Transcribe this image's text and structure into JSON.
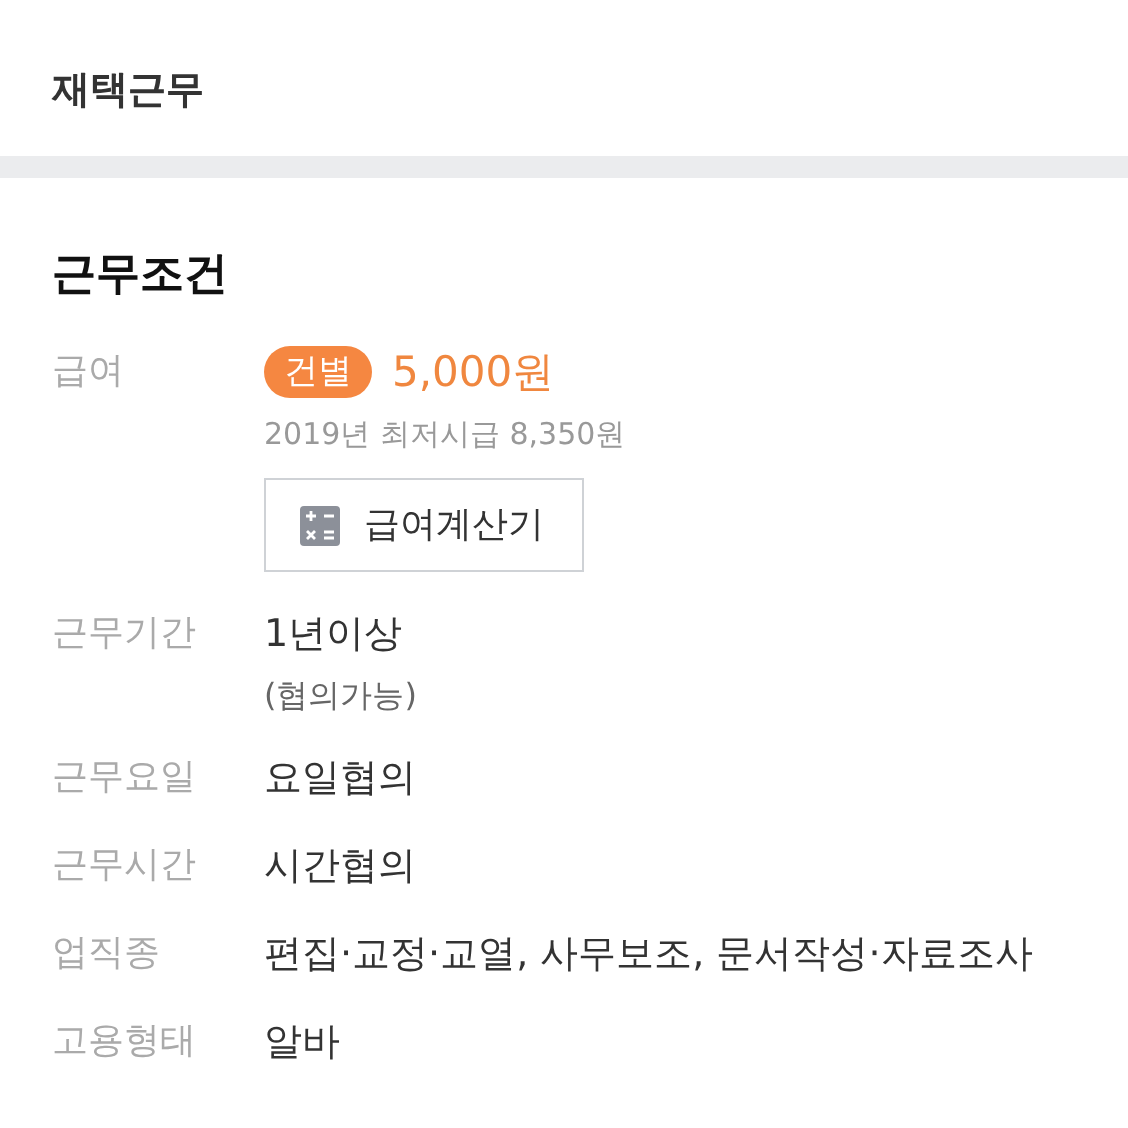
{
  "top_item": "재택근무",
  "section": {
    "title": "근무조건",
    "rows": [
      {
        "kind": "salary",
        "label": "급여",
        "badge": "건별",
        "amount": "5,000원",
        "note": "2019년 최저시급 8,350원",
        "button": "급여계산기"
      },
      {
        "kind": "text",
        "label": "근무기간",
        "value": "1년이상",
        "note": "(협의가능)"
      },
      {
        "kind": "text",
        "label": "근무요일",
        "value": "요일협의"
      },
      {
        "kind": "text",
        "label": "근무시간",
        "value": "시간협의"
      },
      {
        "kind": "text",
        "label": "업직종",
        "value": "편집·교정·교열, 사무보조, 문서작성·자료조사"
      },
      {
        "kind": "text",
        "label": "고용형태",
        "value": "알바"
      }
    ]
  }
}
